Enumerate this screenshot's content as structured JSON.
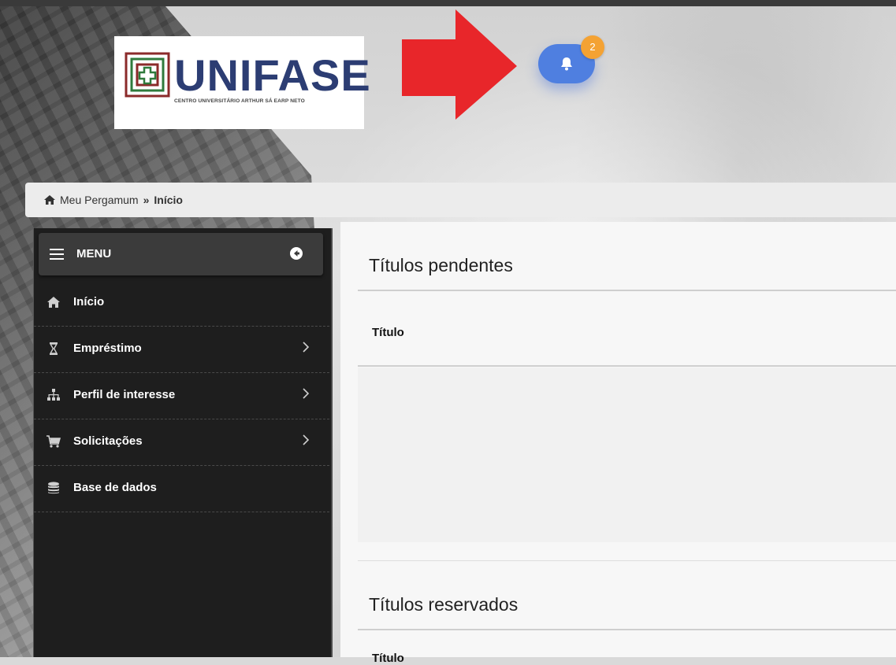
{
  "logo": {
    "name": "UNIFASE",
    "subtitle": "CENTRO UNIVERSITÁRIO ARTHUR SÁ EARP NETO"
  },
  "notifications": {
    "count": "2",
    "icon": "bell-icon",
    "accent": "#4f7fe0",
    "badge_color": "#f4a233"
  },
  "annotation": {
    "icon": "red-arrow",
    "color": "#e8262a"
  },
  "breadcrumb": {
    "home": "Meu Pergamum",
    "separator": "»",
    "current": "Início"
  },
  "sidebar": {
    "title": "MENU",
    "items": [
      {
        "label": "Início",
        "icon": "home-icon",
        "has_submenu": false
      },
      {
        "label": "Empréstimo",
        "icon": "hourglass-icon",
        "has_submenu": true
      },
      {
        "label": "Perfil de interesse",
        "icon": "sitemap-icon",
        "has_submenu": true
      },
      {
        "label": "Solicitações",
        "icon": "cart-icon",
        "has_submenu": true
      },
      {
        "label": "Base de dados",
        "icon": "database-icon",
        "has_submenu": false
      }
    ]
  },
  "main": {
    "pending": {
      "title": "Títulos pendentes",
      "column": "Título"
    },
    "reserved": {
      "title": "Títulos reservados",
      "column": "Título"
    }
  }
}
